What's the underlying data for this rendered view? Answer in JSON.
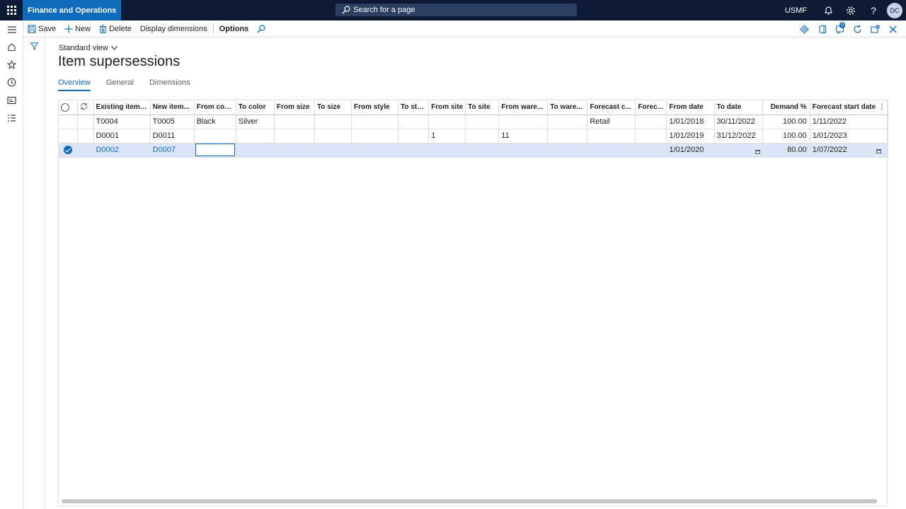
{
  "app": {
    "name": "Finance and Operations",
    "company": "USMF",
    "user_initials": "DC"
  },
  "search": {
    "placeholder": "Search for a page"
  },
  "actions": {
    "save": "Save",
    "new": "New",
    "delete": "Delete",
    "display_dimensions": "Display dimensions",
    "options": "Options"
  },
  "notifications_badge": "0",
  "page": {
    "view": "Standard view",
    "title": "Item supersessions"
  },
  "tabs": [
    "Overview",
    "General",
    "Dimensions"
  ],
  "grid": {
    "columns": [
      "Existing item ...",
      "New item...",
      "From color",
      "To color",
      "From size",
      "To size",
      "From style",
      "To style",
      "From site",
      "To site",
      "From ware...",
      "To ware...",
      "Forecast c...",
      "Forec...",
      "From date",
      "To date",
      "Demand %",
      "Forecast start date"
    ],
    "rows": [
      [
        "T0004",
        "T0005",
        "Black",
        "Silver",
        "",
        "",
        "",
        "",
        "",
        "",
        "",
        "",
        "Retail",
        "",
        "1/01/2018",
        "30/11/2022",
        "100.00",
        "1/11/2022"
      ],
      [
        "D0001",
        "D0011",
        "",
        "",
        "",
        "",
        "",
        "",
        "1",
        "",
        "11",
        "",
        "",
        "",
        "1/01/2019",
        "31/12/2022",
        "100.00",
        "1/01/2023"
      ],
      [
        "D0002",
        "D0007",
        "",
        "",
        "",
        "",
        "",
        "",
        "",
        "",
        "",
        "",
        "",
        "",
        "1/01/2020",
        "",
        "80.00",
        "1/07/2022"
      ]
    ],
    "selected_row": 2
  },
  "icons": {
    "waffle": "app-launcher-icon",
    "bell": "notification-bell-icon",
    "gear": "settings-gear-icon",
    "help": "help-icon",
    "hamburger": "menu-icon",
    "home": "home-icon",
    "star": "favorites-icon",
    "clock": "recent-icon",
    "workspaces": "workspaces-icon",
    "modules": "modules-icon",
    "filter": "filter-icon"
  },
  "colors": {
    "topbar": "#0d1a33",
    "accent": "#0f6cbd",
    "selected_row": "#dbe5f7"
  }
}
